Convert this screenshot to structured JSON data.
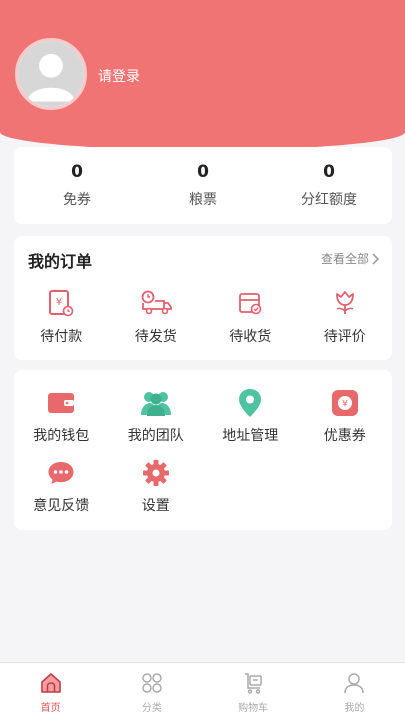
{
  "header": {
    "login_text": "请登录"
  },
  "stats": [
    {
      "value": "0",
      "label": "免券"
    },
    {
      "value": "0",
      "label": "粮票"
    },
    {
      "value": "0",
      "label": "分红额度"
    }
  ],
  "orders": {
    "title": "我的订单",
    "view_all": "查看全部",
    "items": [
      {
        "label": "待付款",
        "icon": "payment-icon"
      },
      {
        "label": "待发货",
        "icon": "truck-icon"
      },
      {
        "label": "待收货",
        "icon": "package-icon"
      },
      {
        "label": "待评价",
        "icon": "flower-icon"
      }
    ]
  },
  "tools": [
    {
      "label": "我的钱包",
      "icon": "wallet-icon"
    },
    {
      "label": "我的团队",
      "icon": "team-icon"
    },
    {
      "label": "地址管理",
      "icon": "location-icon"
    },
    {
      "label": "优惠券",
      "icon": "coupon-icon"
    },
    {
      "label": "意见反馈",
      "icon": "feedback-icon"
    },
    {
      "label": "设置",
      "icon": "gear-icon"
    }
  ],
  "tabbar": [
    {
      "label": "首页",
      "icon": "home-icon",
      "active": true
    },
    {
      "label": "分类",
      "icon": "category-icon",
      "active": false
    },
    {
      "label": "购物车",
      "icon": "cart-icon",
      "active": false
    },
    {
      "label": "我的",
      "icon": "profile-icon",
      "active": false
    }
  ],
  "colors": {
    "brand": "#f07474",
    "teal": "#4fc3a1",
    "active_tab": "#e25555"
  }
}
